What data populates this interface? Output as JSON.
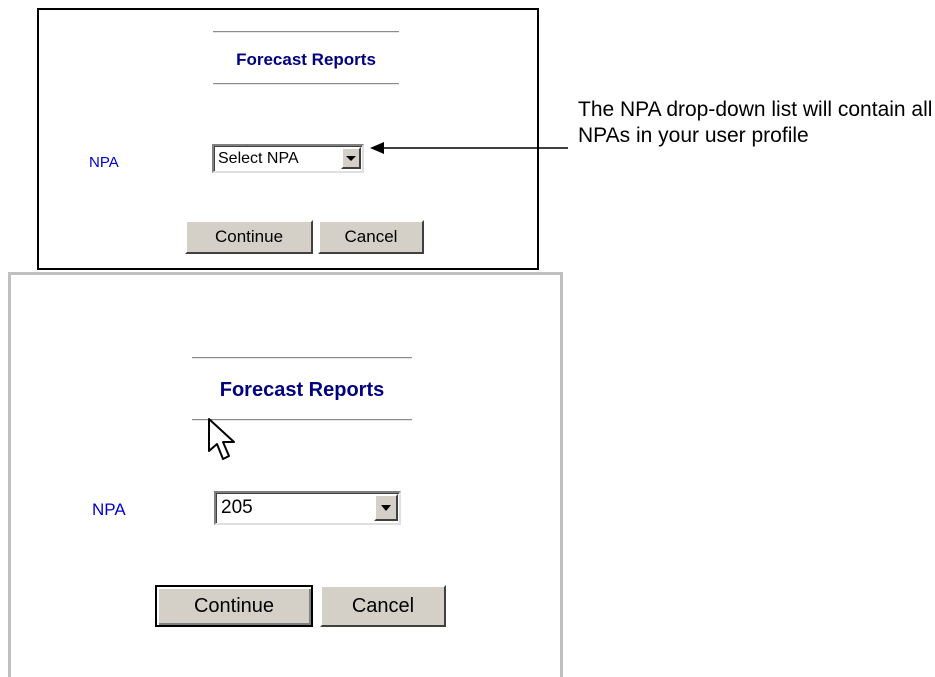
{
  "panel_top": {
    "title": "Forecast Reports",
    "npa_label": "NPA",
    "npa_select_value": "Select NPA",
    "continue_label": "Continue",
    "cancel_label": "Cancel"
  },
  "annotation": {
    "text": "The NPA drop-down list will contain all NPAs in your user profile"
  },
  "panel_bottom": {
    "title": "Forecast Reports",
    "npa_label": "NPA",
    "npa_select_value": "205",
    "continue_label": "Continue",
    "cancel_label": "Cancel"
  },
  "colors": {
    "title_navy": "#000080",
    "label_blue": "#0000cc",
    "button_face": "#d4d0c8"
  },
  "icons": {
    "dropdown": "chevron-down-icon",
    "cursor": "mouse-pointer-icon",
    "callout": "arrow-left-icon"
  }
}
